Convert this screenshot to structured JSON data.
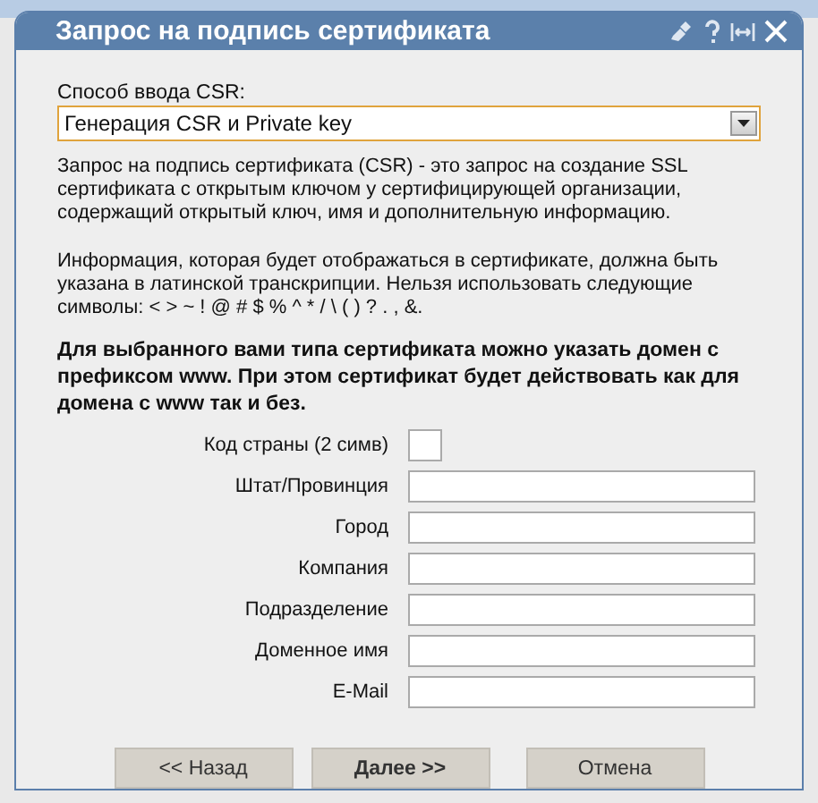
{
  "dialog": {
    "title": "Запрос на подпись сертификата"
  },
  "csr_method": {
    "label": "Способ ввода CSR:",
    "value": "Генерация CSR и Private key"
  },
  "paragraphs": [
    "Запрос на подпись сертификата (CSR) - это запрос на создание SSL сертификата с открытым ключом у сертифицирующей организации, содержащий открытый ключ, имя и дополнительную информацию.",
    "Информация, которая будет отображаться в сертификате, должна быть указана в латинской транскрипции. Нельзя использовать следующие символы: < > ~ ! @ # $ % ^ * / \\ ( ) ? . , &."
  ],
  "notice": "Для выбранного вами типа сертификата можно указать домен с префиксом www. При этом сертификат будет действовать как для домена с www так и без.",
  "fields": [
    {
      "label": "Код страны (2 симв)",
      "kind": "short"
    },
    {
      "label": "Штат/Провинция",
      "kind": "long"
    },
    {
      "label": "Город",
      "kind": "long"
    },
    {
      "label": "Компания",
      "kind": "long"
    },
    {
      "label": "Подразделение",
      "kind": "long"
    },
    {
      "label": "Доменное имя",
      "kind": "long"
    },
    {
      "label": "E-Mail",
      "kind": "long"
    }
  ],
  "buttons": [
    {
      "label": "<< Назад",
      "primary": false
    },
    {
      "label": "Далее >>",
      "primary": true
    },
    {
      "label": "Отмена",
      "primary": false
    }
  ]
}
